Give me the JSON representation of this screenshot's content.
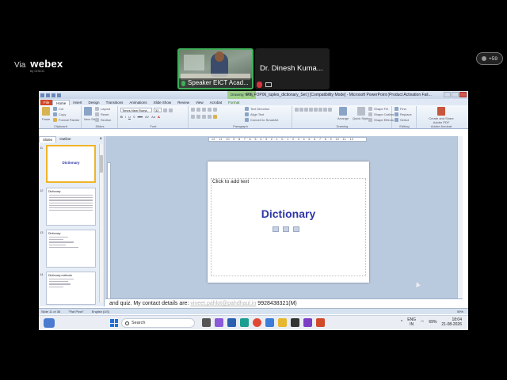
{
  "webex": {
    "via_label": "Via",
    "brand": "webex",
    "brand_sub": "by CISCO",
    "tiles": [
      {
        "name": "Speaker EICT Acad..."
      },
      {
        "name": "Dr. Dinesh Kuma..."
      }
    ],
    "participants_count": "+59"
  },
  "ppt": {
    "window_title": "PY_FOP06_tuples_dictionary_Set ] [Compatibility Mode] - Microsoft PowerPoint (Product Activation Fail...",
    "contextual_tab": "Drawing Tools",
    "tabs": [
      "File",
      "Home",
      "Insert",
      "Design",
      "Transitions",
      "Animations",
      "Slide Show",
      "Review",
      "View",
      "Acrobat",
      "Format"
    ],
    "ribbon_groups": [
      "Clipboard",
      "Slides",
      "Font",
      "Paragraph",
      "Drawing",
      "Editing",
      "Adobe Acrobat"
    ],
    "clipboard": {
      "paste": "Paste",
      "cut": "Cut",
      "copy": "Copy",
      "format_painter": "Format Painter"
    },
    "slides_group": {
      "new_slide": "New Slide",
      "layout": "Layout",
      "reset": "Reset",
      "section": "Section"
    },
    "font": {
      "name": "Times New Roma",
      "size": "32",
      "buttons": [
        "B",
        "I",
        "U",
        "S",
        "abc",
        "AV",
        "Aa",
        "A"
      ]
    },
    "paragraph": {
      "text_direction": "Text Direction",
      "align_text": "Align Text",
      "convert_smartart": "Convert to SmartArt"
    },
    "drawing": {
      "arrange": "Arrange",
      "quick_styles": "Quick Styles",
      "shape_fill": "Shape Fill",
      "shape_outline": "Shape Outline",
      "shape_effects": "Shape Effects"
    },
    "editing": {
      "find": "Find",
      "replace": "Replace",
      "select": "Select"
    },
    "acrobat": {
      "create_share": "Create and Share Adobe PDF"
    },
    "left_pane": {
      "tabs": [
        "Slides",
        "Outline"
      ],
      "thumbnails": [
        {
          "number": "11",
          "title": "Dictionary"
        },
        {
          "number": "12",
          "title": "Dictionary"
        },
        {
          "number": "13",
          "title": "Dictionary"
        },
        {
          "number": "14",
          "title": "Dictionary methods"
        }
      ]
    },
    "ruler": "12 · 11 · 10 · 9 · 8 · 7 · 6 · 5 · 4 · 3 · 2 · 1 · 0 · 1 · 2 · 3 · 4 · 5 · 6 · 7 · 8 · 9 · 10 · 11 · 12",
    "slide": {
      "placeholder_text": "Click to add text",
      "title": "Dictionary"
    },
    "notes": {
      "text_before": "and quiz. My contact details are: ",
      "email": "vineet.pahlot@pahdhaul.in",
      "text_after": "  9928438321(M)"
    },
    "status": {
      "slide_info": "Slide 11 of 36",
      "theme": "\"Flat Pivot\"",
      "language": "English (US)",
      "zoom": "59%"
    }
  },
  "taskbar": {
    "search_placeholder": "Search",
    "lang_top": "ENG",
    "lang_bottom": "IN",
    "time": "18:04",
    "date": "21-08-2026",
    "battery": "69%"
  },
  "colors": {
    "slide_title": "#2f37a8",
    "file_tab": "#d24726",
    "speaker_border": "#3fae5a",
    "mute_red": "#d9323a"
  }
}
